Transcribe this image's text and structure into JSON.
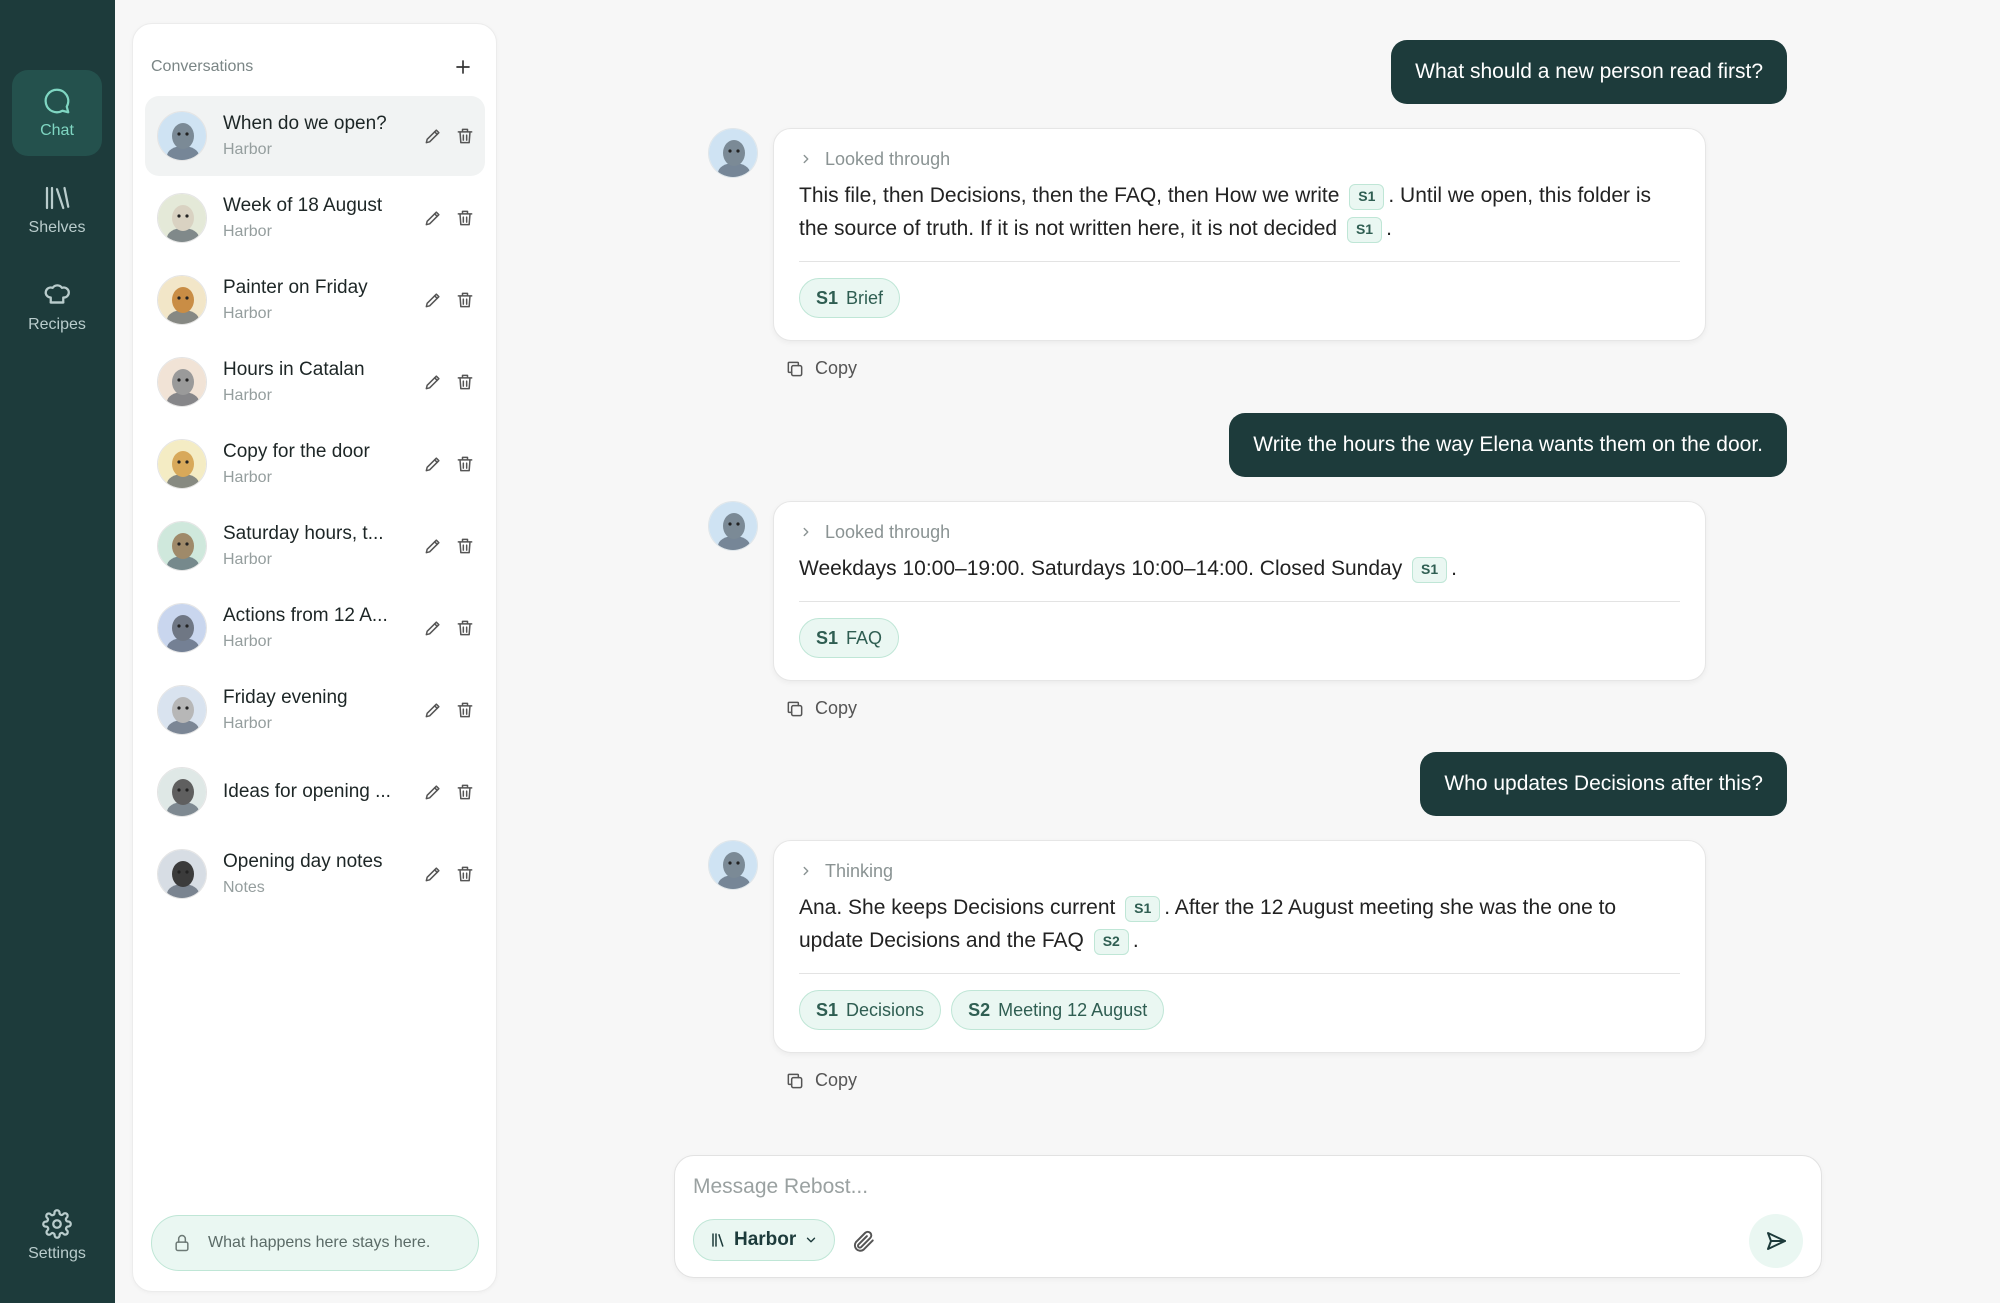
{
  "rail": {
    "items": [
      {
        "label": "Chat",
        "icon": "chat-bubble-icon"
      },
      {
        "label": "Shelves",
        "icon": "shelves-icon"
      },
      {
        "label": "Recipes",
        "icon": "chef-hat-icon"
      }
    ],
    "settings": {
      "label": "Settings",
      "icon": "gear-icon"
    }
  },
  "sidebar": {
    "title": "Conversations",
    "conversations": [
      {
        "title": "When do we open?",
        "shelf": "Harbor",
        "avatar": "seal",
        "active": true
      },
      {
        "title": "Week of 18 August",
        "shelf": "Harbor",
        "avatar": "llama"
      },
      {
        "title": "Painter on Friday",
        "shelf": "Harbor",
        "avatar": "dog"
      },
      {
        "title": "Hours in Catalan",
        "shelf": "Harbor",
        "avatar": "koala"
      },
      {
        "title": "Copy for the door",
        "shelf": "Harbor",
        "avatar": "giraffe"
      },
      {
        "title": "Saturday hours, t...",
        "shelf": "Harbor",
        "avatar": "deer"
      },
      {
        "title": "Actions from 12 A...",
        "shelf": "Harbor",
        "avatar": "wolf"
      },
      {
        "title": "Friday evening",
        "shelf": "Harbor",
        "avatar": "lynx"
      },
      {
        "title": "Ideas for opening ...",
        "shelf": "",
        "avatar": "raccoon"
      },
      {
        "title": "Opening day notes",
        "shelf": "Notes",
        "avatar": "chimp"
      }
    ],
    "privacy": "What happens here stays here."
  },
  "chat": {
    "messages": [
      {
        "question": "What should a new person read first?",
        "status": "Looked through",
        "answer": [
          {
            "t": "This file, then Decisions, then the FAQ, then How we write "
          },
          {
            "c": "S1"
          },
          {
            "t": ". Until we open, this folder is the source of truth. If it is not written here, it is not decided "
          },
          {
            "c": "S1"
          },
          {
            "t": "."
          }
        ],
        "sources": [
          {
            "id": "S1",
            "name": "Brief"
          }
        ]
      },
      {
        "question": "Write the hours the way Elena wants them on the door.",
        "status": "Looked through",
        "answer": [
          {
            "t": "Weekdays 10:00–19:00. Saturdays 10:00–14:00. Closed Sunday "
          },
          {
            "c": "S1"
          },
          {
            "t": "."
          }
        ],
        "sources": [
          {
            "id": "S1",
            "name": "FAQ"
          }
        ]
      },
      {
        "question": "Who updates Decisions after this?",
        "status": "Thinking",
        "answer": [
          {
            "t": "Ana. She keeps Decisions current "
          },
          {
            "c": "S1"
          },
          {
            "t": ". After the 12 August meeting she was the one to update Decisions and the FAQ "
          },
          {
            "c": "S2"
          },
          {
            "t": "."
          }
        ],
        "sources": [
          {
            "id": "S1",
            "name": "Decisions"
          },
          {
            "id": "S2",
            "name": "Meeting 12 August"
          }
        ]
      }
    ],
    "copy_label": "Copy"
  },
  "composer": {
    "placeholder": "Message Rebost...",
    "shelf": "Harbor"
  }
}
